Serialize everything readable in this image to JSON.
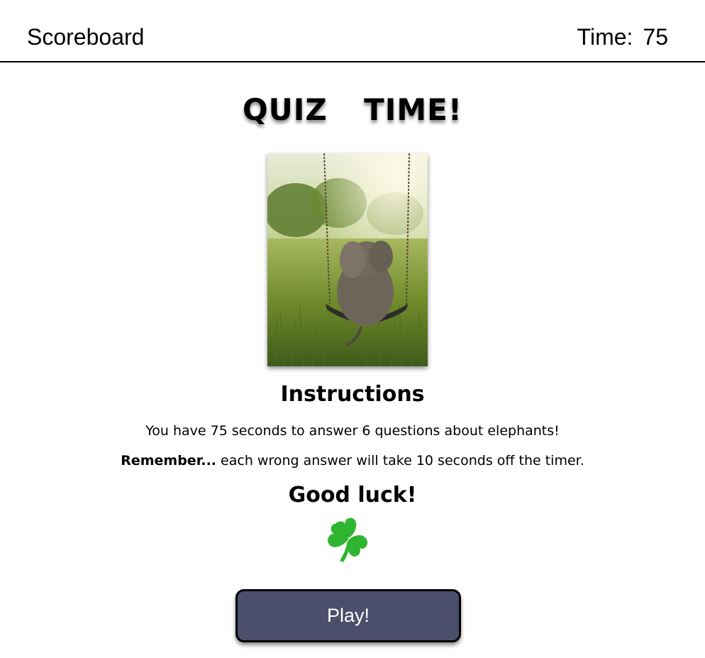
{
  "header": {
    "scoreboard_label": "Scoreboard",
    "timer_label": "Time:",
    "timer_value": "75"
  },
  "main": {
    "title": "QUIZ  TIME!",
    "image_subject": "elephant-on-swing",
    "instructions_heading": "Instructions",
    "line1": "You have 75 seconds to answer 6 questions about elephants!",
    "line2_bold": "Remember...",
    "line2_rest": " each wrong answer will take 10 seconds off the timer.",
    "good_luck": "Good luck!",
    "clover_icon": "shamrock-icon",
    "play_label": "Play!"
  },
  "colors": {
    "play_button_bg": "#4b4f6c",
    "clover": "#2fb52f"
  }
}
